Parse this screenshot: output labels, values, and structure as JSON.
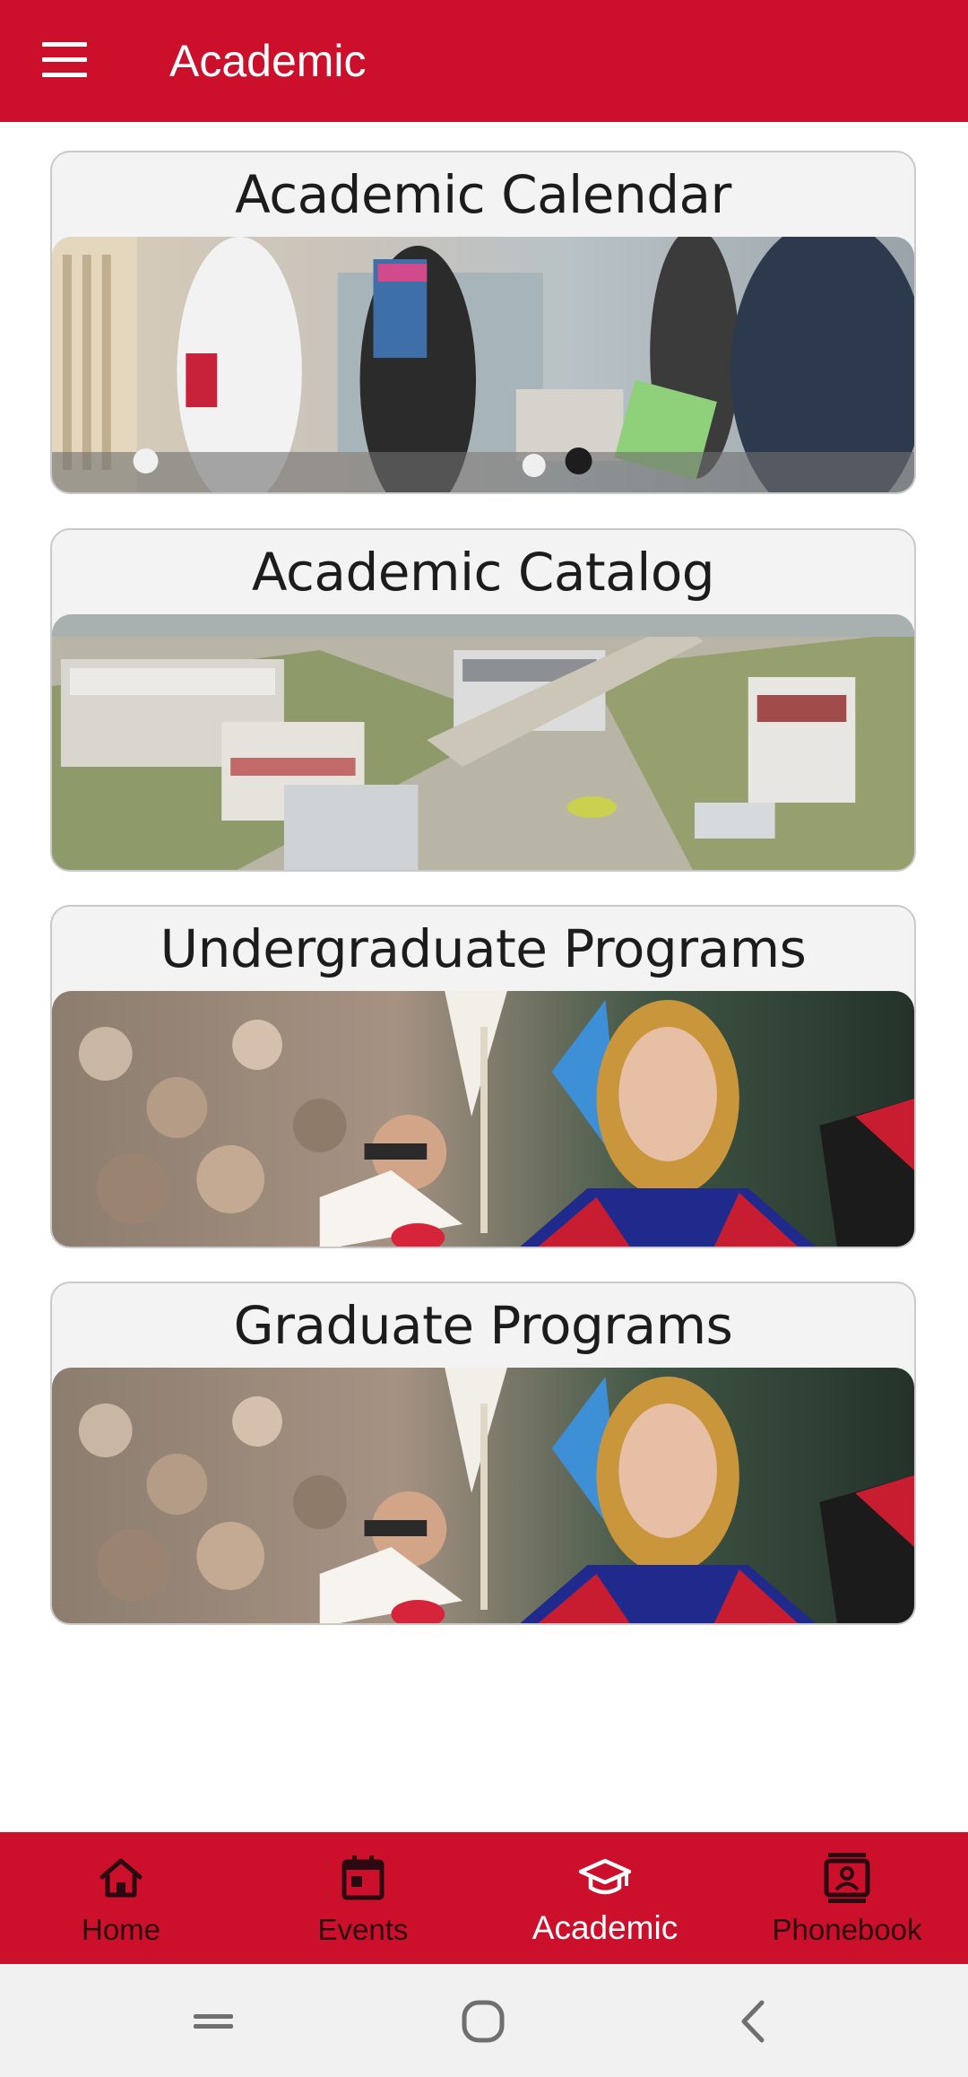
{
  "appbar": {
    "title": "Academic",
    "menu_icon": "hamburger-menu-icon",
    "background": "#cc0f2b"
  },
  "cards": [
    {
      "title": "Academic Calendar",
      "image": "students-walking-on-campus-photo"
    },
    {
      "title": "Academic Catalog",
      "image": "aerial-campus-view-photo"
    },
    {
      "title": "Undergraduate Programs",
      "image": "graduation-ceremony-student-photo"
    },
    {
      "title": "Graduate Programs",
      "image": "graduation-ceremony-student-photo"
    }
  ],
  "bottom_nav": {
    "items": [
      {
        "label": "Home",
        "icon": "home-icon",
        "active": false
      },
      {
        "label": "Events",
        "icon": "calendar-icon",
        "active": false
      },
      {
        "label": "Academic",
        "icon": "graduation-cap-icon",
        "active": true
      },
      {
        "label": "Phonebook",
        "icon": "contacts-book-icon",
        "active": false
      }
    ],
    "active_color": "#ffffff",
    "inactive_color": "#2a0a10"
  },
  "system_nav": {
    "buttons": [
      "recent-apps-icon",
      "home-circle-icon",
      "back-icon"
    ]
  }
}
